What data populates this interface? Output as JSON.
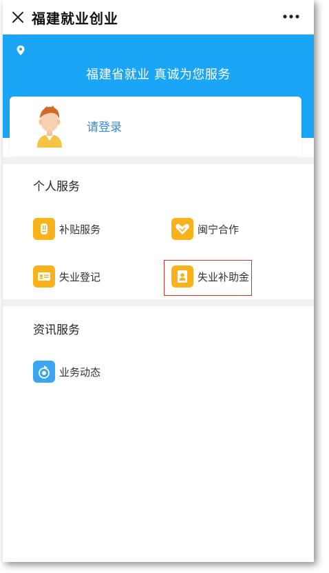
{
  "nav": {
    "title": "福建就业创业"
  },
  "banner": {
    "slogan": "福建省就业 真诚为您服务"
  },
  "login": {
    "label": "请登录"
  },
  "personal_services": {
    "title": "个人服务",
    "items": [
      {
        "label": "补贴服务",
        "icon": "subsidy-icon"
      },
      {
        "label": "闽宁合作",
        "icon": "handshake-icon"
      },
      {
        "label": "失业登记",
        "icon": "id-card-icon"
      },
      {
        "label": "失业补助金",
        "icon": "person-badge-icon"
      }
    ]
  },
  "info_services": {
    "title": "资讯服务",
    "items": [
      {
        "label": "业务动态",
        "icon": "news-dynamic-icon"
      }
    ]
  },
  "colors": {
    "banner": "#1ba5f6",
    "service_icon_orange": "#f7b21c",
    "info_icon_blue": "#3aa5f0",
    "login_text": "#3a8bd2",
    "highlight": "#d9302c"
  }
}
